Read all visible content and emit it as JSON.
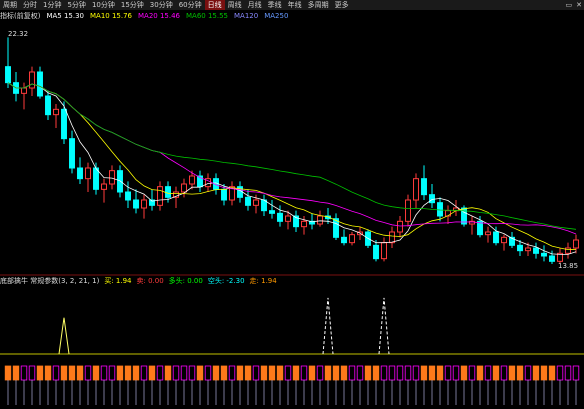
{
  "toolbar": {
    "items": [
      "周期",
      "分时",
      "1分钟",
      "5分钟",
      "10分钟",
      "15分钟",
      "30分钟",
      "60分钟",
      "日线",
      "周线",
      "月线",
      "季线",
      "年线",
      "多周期",
      "更多"
    ],
    "active_index": 8
  },
  "infobar": {
    "title": "指标(前复权)",
    "ma5": "MA5 15.30",
    "ma10": "MA10 15.76",
    "ma20": "MA20 15.46",
    "ma60": "MA60 15.55",
    "ma120": "MA120",
    "ma250": "MA250"
  },
  "indicator": {
    "title": "底部擒牛 常规参数(3, 2, 21, 1)",
    "v1": "买: 1.94",
    "v2": "卖: 0.00",
    "v3": "多头: 0.00",
    "v4": "空头: -2.30",
    "v5": "走: 1.94"
  },
  "colors": {
    "up": "#ff3b3b",
    "down": "#00ffff",
    "ma5": "#ffffff",
    "ma10": "#ffff00",
    "ma20": "#ff00ff",
    "ma60": "#00c000",
    "bg": "#000000"
  },
  "chart_data": {
    "type": "candlestick",
    "high_label": "22.32",
    "low_label": "13.85",
    "ylim": [
      13.5,
      22.8
    ],
    "candles": [
      {
        "o": 21.2,
        "h": 22.3,
        "l": 20.4,
        "c": 20.6
      },
      {
        "o": 20.6,
        "h": 21.0,
        "l": 19.9,
        "c": 20.2
      },
      {
        "o": 20.2,
        "h": 20.6,
        "l": 19.6,
        "c": 20.4
      },
      {
        "o": 20.4,
        "h": 21.2,
        "l": 20.1,
        "c": 21.0
      },
      {
        "o": 21.0,
        "h": 21.2,
        "l": 20.0,
        "c": 20.1
      },
      {
        "o": 20.1,
        "h": 20.3,
        "l": 19.2,
        "c": 19.4
      },
      {
        "o": 19.4,
        "h": 19.8,
        "l": 18.9,
        "c": 19.6
      },
      {
        "o": 19.6,
        "h": 19.9,
        "l": 18.3,
        "c": 18.5
      },
      {
        "o": 18.5,
        "h": 18.8,
        "l": 17.2,
        "c": 17.4
      },
      {
        "o": 17.4,
        "h": 17.8,
        "l": 16.8,
        "c": 17.0
      },
      {
        "o": 17.0,
        "h": 17.6,
        "l": 16.5,
        "c": 17.4
      },
      {
        "o": 17.4,
        "h": 17.6,
        "l": 16.4,
        "c": 16.6
      },
      {
        "o": 16.6,
        "h": 17.0,
        "l": 16.1,
        "c": 16.8
      },
      {
        "o": 16.8,
        "h": 17.5,
        "l": 16.6,
        "c": 17.3
      },
      {
        "o": 17.3,
        "h": 17.5,
        "l": 16.3,
        "c": 16.5
      },
      {
        "o": 16.5,
        "h": 16.9,
        "l": 15.9,
        "c": 16.2
      },
      {
        "o": 16.2,
        "h": 16.6,
        "l": 15.7,
        "c": 15.9
      },
      {
        "o": 15.9,
        "h": 16.4,
        "l": 15.5,
        "c": 16.2
      },
      {
        "o": 16.2,
        "h": 16.6,
        "l": 15.8,
        "c": 16.0
      },
      {
        "o": 16.0,
        "h": 16.9,
        "l": 15.8,
        "c": 16.7
      },
      {
        "o": 16.7,
        "h": 16.9,
        "l": 16.1,
        "c": 16.3
      },
      {
        "o": 16.3,
        "h": 16.7,
        "l": 15.9,
        "c": 16.5
      },
      {
        "o": 16.5,
        "h": 17.0,
        "l": 16.3,
        "c": 16.8
      },
      {
        "o": 16.8,
        "h": 17.3,
        "l": 16.6,
        "c": 17.1
      },
      {
        "o": 17.1,
        "h": 17.3,
        "l": 16.5,
        "c": 16.7
      },
      {
        "o": 16.7,
        "h": 17.2,
        "l": 16.5,
        "c": 17.0
      },
      {
        "o": 17.0,
        "h": 17.2,
        "l": 16.4,
        "c": 16.6
      },
      {
        "o": 16.6,
        "h": 16.8,
        "l": 16.0,
        "c": 16.2
      },
      {
        "o": 16.2,
        "h": 16.9,
        "l": 16.0,
        "c": 16.7
      },
      {
        "o": 16.7,
        "h": 16.9,
        "l": 16.1,
        "c": 16.3
      },
      {
        "o": 16.3,
        "h": 16.6,
        "l": 15.8,
        "c": 16.0
      },
      {
        "o": 16.0,
        "h": 16.4,
        "l": 15.7,
        "c": 16.2
      },
      {
        "o": 16.2,
        "h": 16.4,
        "l": 15.6,
        "c": 15.8
      },
      {
        "o": 15.8,
        "h": 16.2,
        "l": 15.5,
        "c": 15.7
      },
      {
        "o": 15.7,
        "h": 16.0,
        "l": 15.2,
        "c": 15.4
      },
      {
        "o": 15.4,
        "h": 15.8,
        "l": 15.1,
        "c": 15.6
      },
      {
        "o": 15.6,
        "h": 15.8,
        "l": 15.0,
        "c": 15.2
      },
      {
        "o": 15.2,
        "h": 15.6,
        "l": 14.9,
        "c": 15.4
      },
      {
        "o": 15.4,
        "h": 15.7,
        "l": 15.1,
        "c": 15.3
      },
      {
        "o": 15.3,
        "h": 15.8,
        "l": 15.2,
        "c": 15.6
      },
      {
        "o": 15.6,
        "h": 15.9,
        "l": 15.3,
        "c": 15.5
      },
      {
        "o": 15.5,
        "h": 15.7,
        "l": 14.7,
        "c": 14.8
      },
      {
        "o": 14.8,
        "h": 15.1,
        "l": 14.5,
        "c": 14.6
      },
      {
        "o": 14.6,
        "h": 15.0,
        "l": 14.5,
        "c": 14.9
      },
      {
        "o": 14.9,
        "h": 15.2,
        "l": 14.7,
        "c": 15.0
      },
      {
        "o": 15.0,
        "h": 15.1,
        "l": 14.4,
        "c": 14.5
      },
      {
        "o": 14.5,
        "h": 14.7,
        "l": 13.9,
        "c": 14.0
      },
      {
        "o": 14.0,
        "h": 14.8,
        "l": 13.9,
        "c": 14.6
      },
      {
        "o": 14.6,
        "h": 15.2,
        "l": 14.4,
        "c": 15.0
      },
      {
        "o": 15.0,
        "h": 15.6,
        "l": 14.8,
        "c": 15.4
      },
      {
        "o": 15.4,
        "h": 16.4,
        "l": 15.2,
        "c": 16.2
      },
      {
        "o": 16.2,
        "h": 17.2,
        "l": 15.9,
        "c": 17.0
      },
      {
        "o": 17.0,
        "h": 17.5,
        "l": 16.2,
        "c": 16.4
      },
      {
        "o": 16.4,
        "h": 16.8,
        "l": 15.9,
        "c": 16.1
      },
      {
        "o": 16.1,
        "h": 16.3,
        "l": 15.4,
        "c": 15.6
      },
      {
        "o": 15.6,
        "h": 16.0,
        "l": 15.3,
        "c": 15.8
      },
      {
        "o": 15.8,
        "h": 16.2,
        "l": 15.6,
        "c": 15.9
      },
      {
        "o": 15.9,
        "h": 16.0,
        "l": 15.2,
        "c": 15.3
      },
      {
        "o": 15.3,
        "h": 15.6,
        "l": 14.9,
        "c": 15.4
      },
      {
        "o": 15.4,
        "h": 15.6,
        "l": 14.8,
        "c": 14.9
      },
      {
        "o": 14.9,
        "h": 15.2,
        "l": 14.6,
        "c": 15.0
      },
      {
        "o": 15.0,
        "h": 15.2,
        "l": 14.5,
        "c": 14.6
      },
      {
        "o": 14.6,
        "h": 14.9,
        "l": 14.3,
        "c": 14.8
      },
      {
        "o": 14.8,
        "h": 15.0,
        "l": 14.4,
        "c": 14.5
      },
      {
        "o": 14.5,
        "h": 14.7,
        "l": 14.1,
        "c": 14.3
      },
      {
        "o": 14.3,
        "h": 14.6,
        "l": 14.1,
        "c": 14.4
      },
      {
        "o": 14.4,
        "h": 14.6,
        "l": 14.0,
        "c": 14.2
      },
      {
        "o": 14.2,
        "h": 14.5,
        "l": 13.9,
        "c": 14.1
      },
      {
        "o": 14.1,
        "h": 14.3,
        "l": 13.8,
        "c": 13.9
      },
      {
        "o": 13.9,
        "h": 14.4,
        "l": 13.8,
        "c": 14.2
      },
      {
        "o": 14.2,
        "h": 14.6,
        "l": 14.0,
        "c": 14.4
      },
      {
        "o": 14.4,
        "h": 14.9,
        "l": 14.2,
        "c": 14.7
      }
    ],
    "indicator_peaks": [
      0.55,
      0.85,
      0.85
    ]
  }
}
